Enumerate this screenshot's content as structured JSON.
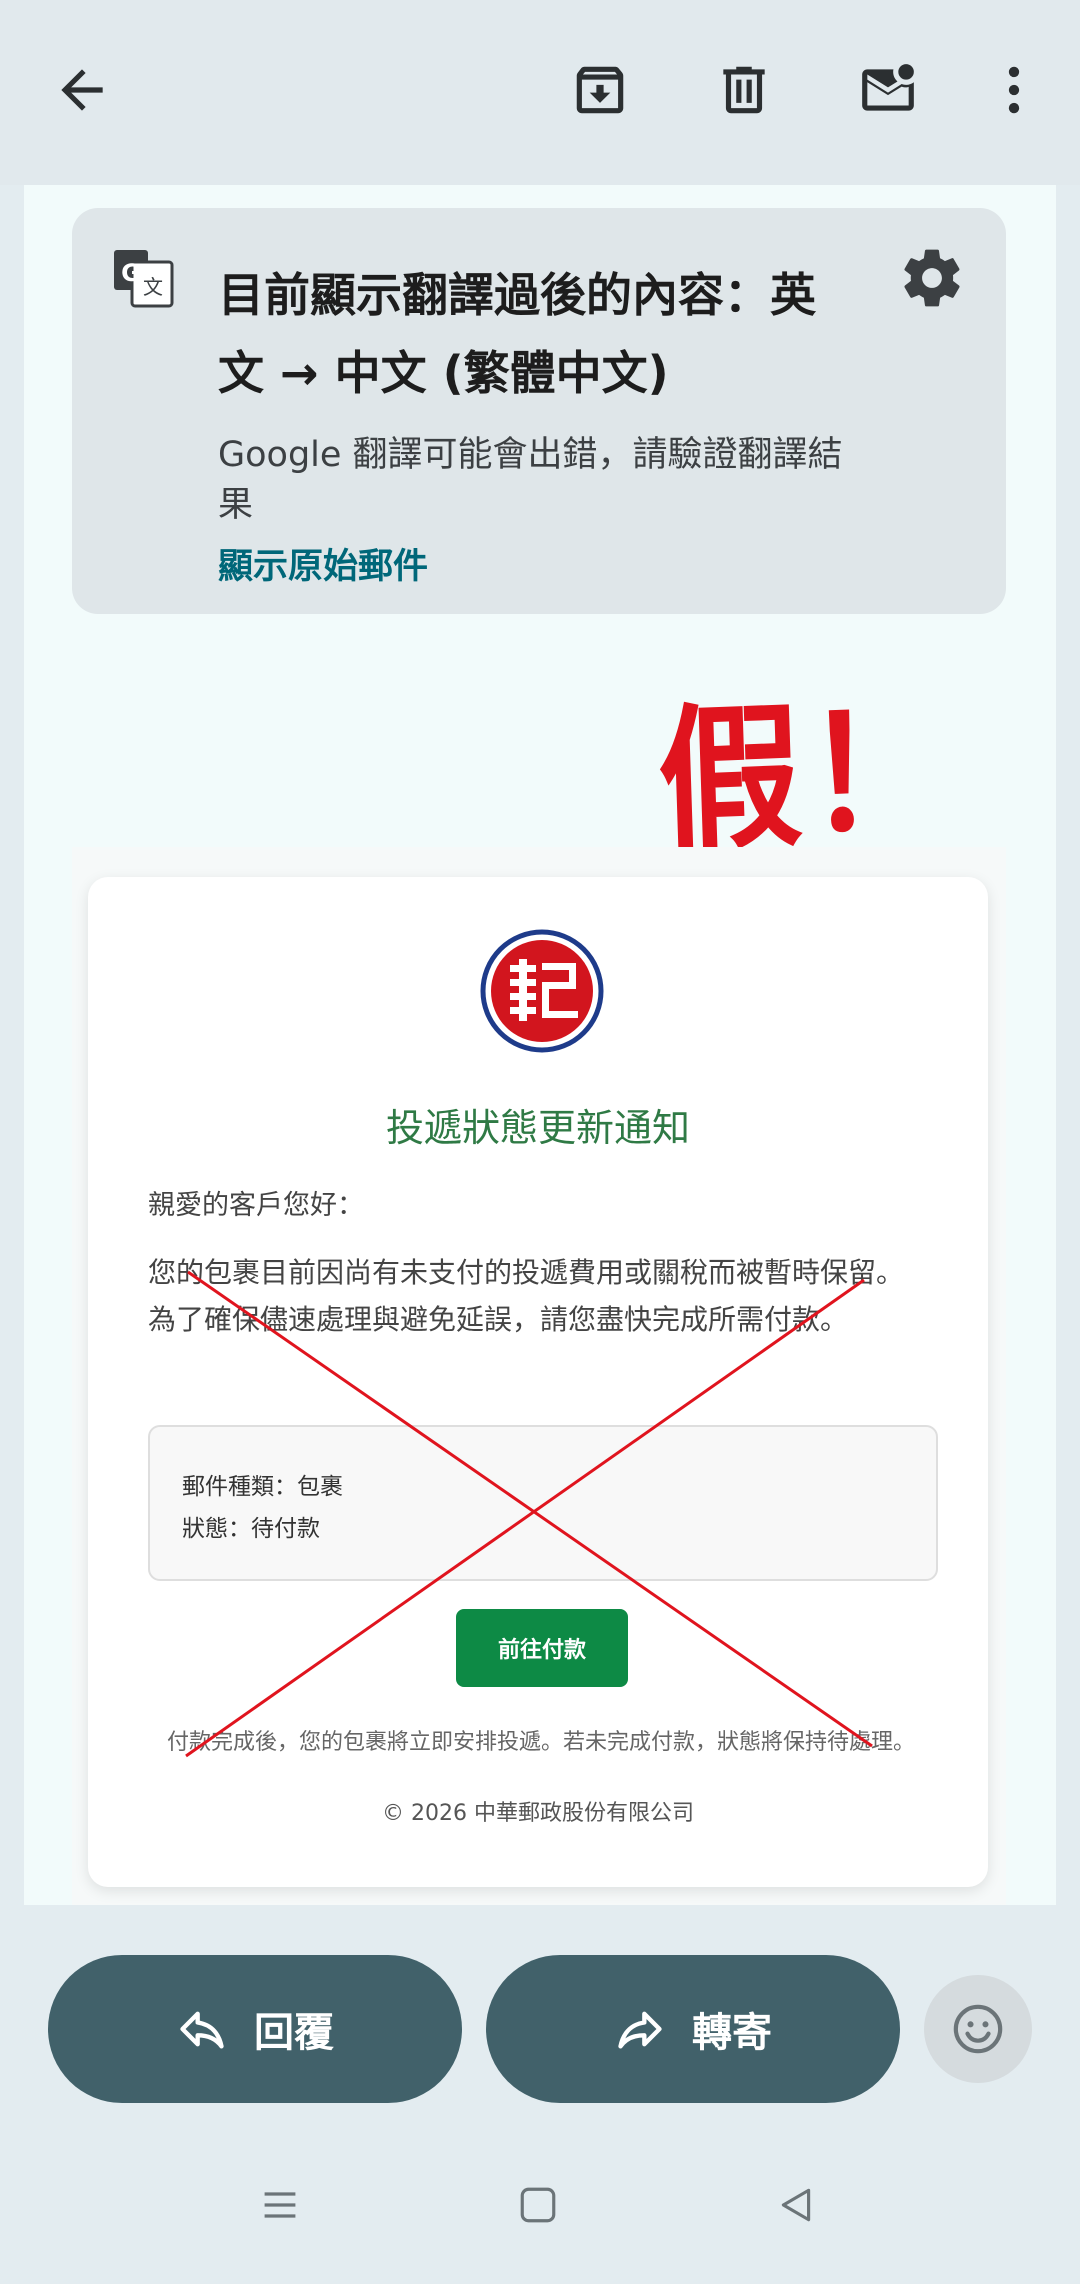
{
  "toolbar": {
    "back_icon": "arrow-left-icon",
    "archive_icon": "archive-icon",
    "delete_icon": "trash-icon",
    "mark_unread_icon": "mail-unread-icon",
    "more_icon": "more-vert-icon"
  },
  "translation_banner": {
    "title": "目前顯示翻譯過後的內容：英文 → 中文 (繁體中文)",
    "note": "Google 翻譯可能會出錯，請驗證翻譯結果",
    "show_original": "顯示原始郵件"
  },
  "overlay": {
    "fake_stamp": "假！",
    "stamp_color": "#e0141e"
  },
  "email": {
    "title": "投遞狀態更新通知",
    "greeting": "親愛的客戶您好：",
    "body": "您的包裹目前因尚有未支付的投遞費用或關稅而被暫時保留。為了確保儘速處理與避免延誤，請您盡快完成所需付款。",
    "info": {
      "item_type": "郵件種類：包裹",
      "status": "狀態：待付款"
    },
    "pay_button": "前往付款",
    "footnote": "付款完成後，您的包裹將立即安排投遞。若未完成付款，狀態將保持待處理。",
    "copyright": "© 2026 中華郵政股份有限公司"
  },
  "actions": {
    "reply": "回覆",
    "forward": "轉寄"
  },
  "colors": {
    "accent_link": "#006779",
    "action_pill": "#41616a",
    "pay_green": "#0d8a45"
  }
}
